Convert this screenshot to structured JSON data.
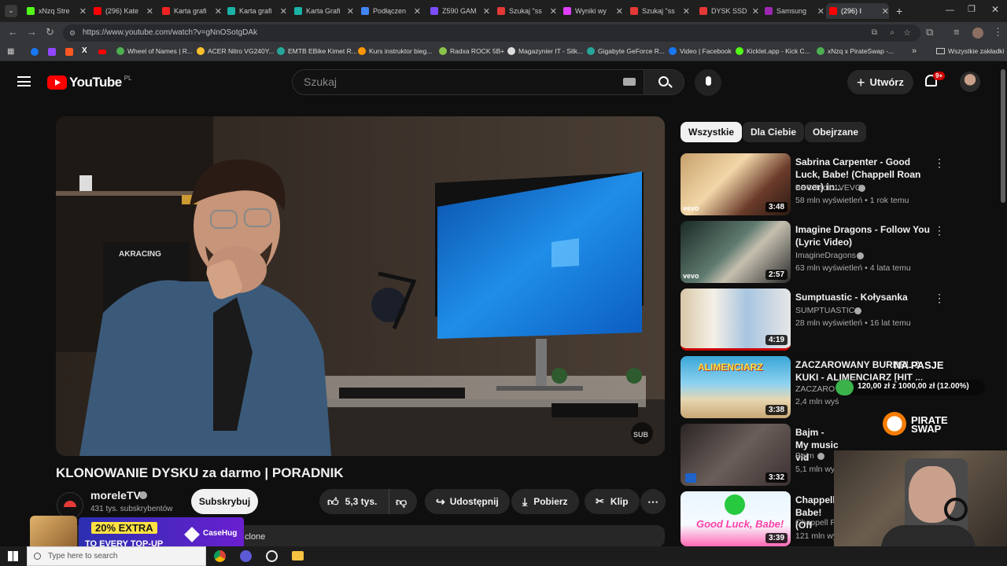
{
  "browser": {
    "tabs": [
      {
        "label": "xNzq Stre",
        "color": "#53fc18"
      },
      {
        "label": "(296) Kate",
        "color": "#ff0000"
      },
      {
        "label": "Karta grafi",
        "color": "#ee2222"
      },
      {
        "label": "Karta grafi",
        "color": "#1ab3a6"
      },
      {
        "label": "Karta Grafi",
        "color": "#1ab3a6"
      },
      {
        "label": "Podłączen",
        "color": "#4285f4"
      },
      {
        "label": "Z590 GAM",
        "color": "#7c4dff"
      },
      {
        "label": "Szukaj \"ss",
        "color": "#e53935"
      },
      {
        "label": "Wyniki wy",
        "color": "#e040fb"
      },
      {
        "label": "Szukaj \"ss",
        "color": "#e53935"
      },
      {
        "label": "DYSK SSD",
        "color": "#e53935"
      },
      {
        "label": "Samsung",
        "color": "#9c27b0"
      },
      {
        "label": "(296) I",
        "color": "#ff0000"
      }
    ],
    "new_tab": "+",
    "url": "https://www.youtube.com/watch?v=gNnOSotgDAk",
    "bookmarks": [
      {
        "label": "Wheel of Names | R...",
        "color": "#4caf50"
      },
      {
        "label": "ACER Nitro VG240Y...",
        "color": "#fbc02d"
      },
      {
        "label": "EMTB EBike Kimet R...",
        "color": "#26a69a"
      },
      {
        "label": "Kurs instruktor bieg...",
        "color": "#ff9800"
      },
      {
        "label": "Radxa ROCK 5B+",
        "color": "#8bc34a"
      },
      {
        "label": "Magazynier IT - Silk...",
        "color": "#dddddd"
      },
      {
        "label": "Gigabyte GeForce R...",
        "color": "#26a69a"
      },
      {
        "label": "Video | Facebook",
        "color": "#1877f2"
      },
      {
        "label": "Kicklet.app - Kick C...",
        "color": "#53fc18"
      },
      {
        "label": "xNzq x PirateSwap -...",
        "color": "#4caf50"
      }
    ],
    "all_bookmarks": "Wszystkie zakładki"
  },
  "youtube": {
    "logo": "YouTube",
    "region": "PL",
    "search_placeholder": "Szukaj",
    "create_label": "Utwórz",
    "notif_count": "9+",
    "chips": [
      "Wszystkie",
      "Dla Ciebie",
      "Obejrzane"
    ],
    "video": {
      "title": "KLONOWANIE DYSKU za darmo | PORADNIK",
      "channel": "moreleTV",
      "subs": "431 tys. subskrybentów",
      "subscribe": "Subskrybuj",
      "likes": "5,3 tys.",
      "share": "Udostępnij",
      "download": "Pobierz",
      "clip": "Klip",
      "desc_fragment": "clone",
      "watermark": "SUB"
    },
    "recommendations": [
      {
        "title": "Sabrina Carpenter - Good Luck, Babe! (Chappell Roan cover) in...",
        "channel": "BBCRadio1VEVO",
        "meta": "58 mln wyświetleń • 1 rok temu",
        "duration": "3:48",
        "verified": true
      },
      {
        "title": "Imagine Dragons - Follow You (Lyric Video)",
        "channel": "ImagineDragons",
        "meta": "63 mln wyświetleń • 4 lata temu",
        "duration": "2:57",
        "verified": true
      },
      {
        "title": "Sumptuastic - Kołysanka",
        "channel": "SUMPTUASTIC",
        "meta": "28 mln wyświetleń • 16 lat temu",
        "duration": "4:19",
        "verified": true
      },
      {
        "title": "ZACZAROWANY BURDEL & KUKI - ALIMENCIARZ [HIT ...",
        "channel": "ZACZARO",
        "meta": "2,4 mln wyś",
        "duration": "3:38",
        "verified": false
      },
      {
        "title": "Bajm - My music vid",
        "channel": "Bajm",
        "meta": "5,1 mln wys",
        "duration": "3:32",
        "verified": true
      },
      {
        "title": "Chappell Babe! (Off",
        "channel": "Chappell Ro",
        "meta": "121 mln wy",
        "duration": "3:39",
        "verified": false
      }
    ]
  },
  "overlays": {
    "na_pasje": "NA PASJE",
    "goal_text": "120,00 zł z 1000,00 zł (12.00%)",
    "goal_progress": 0.12,
    "pirateswap": "PIRATE SWAP",
    "promo": "20% EXTRA",
    "promo_sub": "TO EVERY TOP-UP",
    "casehug": "CaseHug"
  },
  "taskbar": {
    "search_placeholder": "Type here to search"
  }
}
